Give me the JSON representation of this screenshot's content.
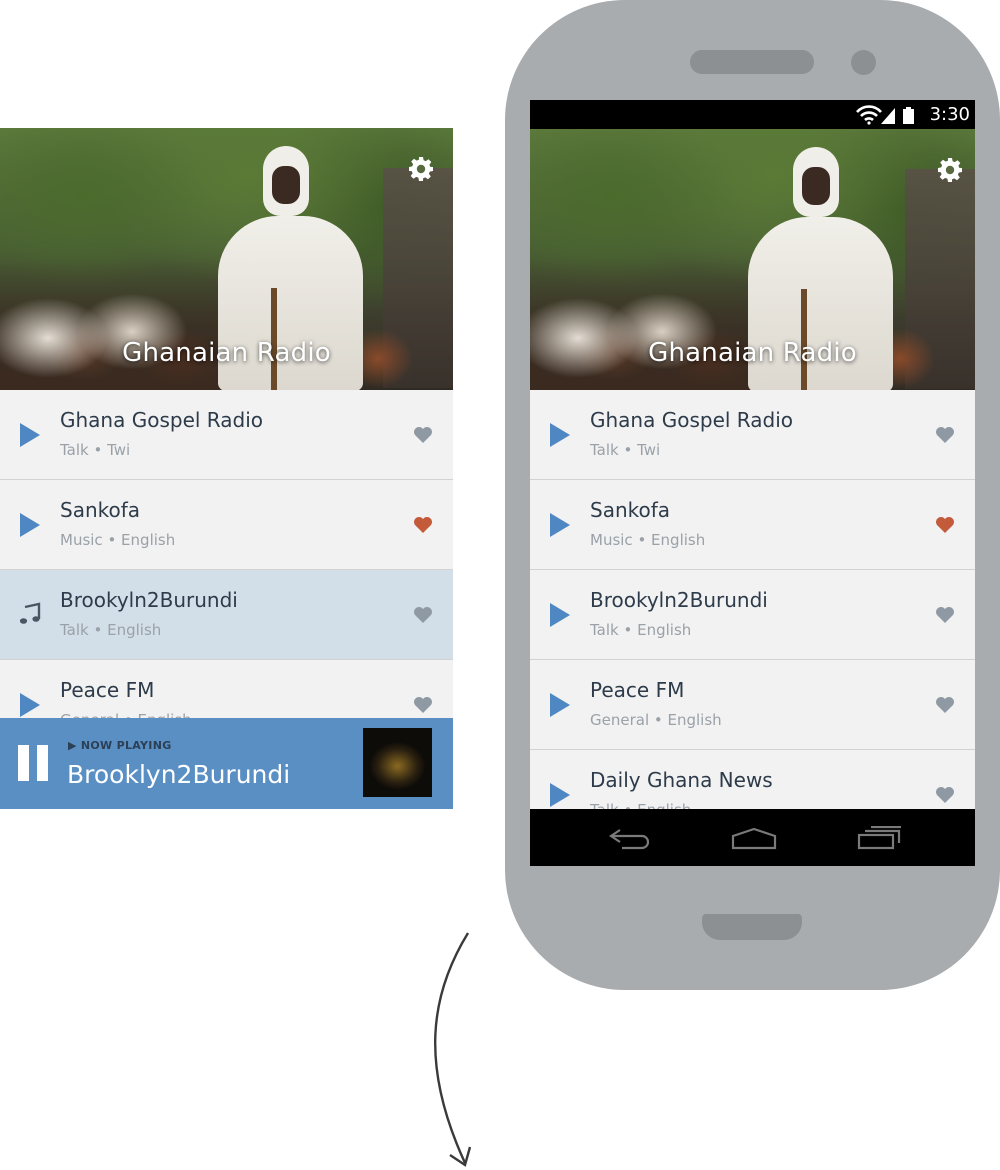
{
  "app": {
    "title": "Ghanaian Radio",
    "settings_icon": "gear-icon"
  },
  "stations": [
    {
      "name": "Ghana Gospel Radio",
      "meta": "Talk • Twi",
      "favorite": false
    },
    {
      "name": "Sankofa",
      "meta": "Music • English",
      "favorite": true
    },
    {
      "name": "Brookyln2Burundi",
      "meta": "Talk • English",
      "favorite": false
    },
    {
      "name": "Peace FM",
      "meta": "General • English",
      "favorite": false
    },
    {
      "name": "Daily Ghana News",
      "meta": "Talk • English",
      "favorite": false
    }
  ],
  "now_playing": {
    "label": "▶ NOW PLAYING",
    "title": "Brooklyn2Burundi"
  },
  "status_bar": {
    "time": "3:30"
  },
  "colors": {
    "accent": "#5a8fc4",
    "play": "#4f87c2",
    "heart_default": "#8f99a3",
    "heart_favorite": "#c35a3a",
    "row_active": "#d3dfe8",
    "phone_body": "#a8acaf"
  }
}
